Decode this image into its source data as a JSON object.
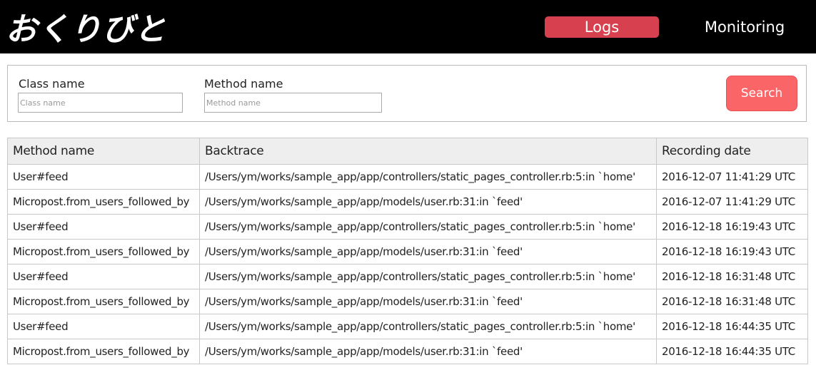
{
  "header": {
    "logo_text": "おくりびと",
    "nav": {
      "logs_label": "Logs",
      "monitoring_label": "Monitoring"
    },
    "colors": {
      "background": "#000000",
      "active_tab": "#d6404f"
    }
  },
  "search": {
    "class_name": {
      "label": "Class name",
      "placeholder": "Class name",
      "value": ""
    },
    "method_name": {
      "label": "Method name",
      "placeholder": "Method name",
      "value": ""
    },
    "button_label": "Search",
    "button_color": "#fa6567"
  },
  "table": {
    "columns": [
      "Method name",
      "Backtrace",
      "Recording date"
    ],
    "rows": [
      {
        "method": "User#feed",
        "backtrace": "/Users/ym/works/sample_app/app/controllers/static_pages_controller.rb:5:in `home'",
        "date": "2016-12-07 11:41:29 UTC"
      },
      {
        "method": "Micropost.from_users_followed_by",
        "backtrace": "/Users/ym/works/sample_app/app/models/user.rb:31:in `feed'",
        "date": "2016-12-07 11:41:29 UTC"
      },
      {
        "method": "User#feed",
        "backtrace": "/Users/ym/works/sample_app/app/controllers/static_pages_controller.rb:5:in `home'",
        "date": "2016-12-18 16:19:43 UTC"
      },
      {
        "method": "Micropost.from_users_followed_by",
        "backtrace": "/Users/ym/works/sample_app/app/models/user.rb:31:in `feed'",
        "date": "2016-12-18 16:19:43 UTC"
      },
      {
        "method": "User#feed",
        "backtrace": "/Users/ym/works/sample_app/app/controllers/static_pages_controller.rb:5:in `home'",
        "date": "2016-12-18 16:31:48 UTC"
      },
      {
        "method": "Micropost.from_users_followed_by",
        "backtrace": "/Users/ym/works/sample_app/app/models/user.rb:31:in `feed'",
        "date": "2016-12-18 16:31:48 UTC"
      },
      {
        "method": "User#feed",
        "backtrace": "/Users/ym/works/sample_app/app/controllers/static_pages_controller.rb:5:in `home'",
        "date": "2016-12-18 16:44:35 UTC"
      },
      {
        "method": "Micropost.from_users_followed_by",
        "backtrace": "/Users/ym/works/sample_app/app/models/user.rb:31:in `feed'",
        "date": "2016-12-18 16:44:35 UTC"
      }
    ]
  }
}
